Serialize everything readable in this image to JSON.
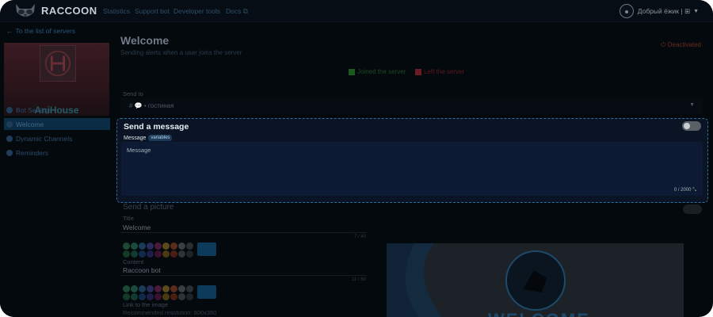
{
  "brand": {
    "name": "RACCOON"
  },
  "nav": {
    "links": [
      "Statistics",
      "Support bot",
      "Developer tools",
      "Docs"
    ]
  },
  "user": {
    "name": "Добрый ёжик | ⊞"
  },
  "sidebar": {
    "back_label": "To the list of servers",
    "server_name": "AniHouse",
    "items": [
      {
        "label": "Bot Settings"
      },
      {
        "label": "Welcome"
      },
      {
        "label": "Dynamic Channels"
      },
      {
        "label": "Reminders"
      }
    ]
  },
  "page": {
    "title": "Welcome",
    "subtitle": "Sending alerts when a user joins the server",
    "deactivate_label": "Deactivated",
    "legend_joined": "Joined the server",
    "legend_left": "Left the server"
  },
  "send_to": {
    "label": "Send to",
    "value": "# 💬 • гостиная"
  },
  "message_panel": {
    "title": "Send a message",
    "message_label": "Message",
    "variables_badge": "variables",
    "placeholder": "Message",
    "counter": "0 / 2000"
  },
  "picture": {
    "section_title": "Send a picture",
    "title_label": "Title",
    "title_value": "Welcome",
    "title_count": "7 / 40",
    "content_label": "Content",
    "content_value": "Raccoon bot",
    "content_count": "11 / 60",
    "image_label": "Link to the image",
    "image_hint": "Recommended resolution: 800x350"
  },
  "preview": {
    "text": "WELCOME"
  },
  "colors": {
    "accent": "#2d6f99",
    "panel_bg": "#0b1424",
    "page_bg": "#04090e"
  }
}
